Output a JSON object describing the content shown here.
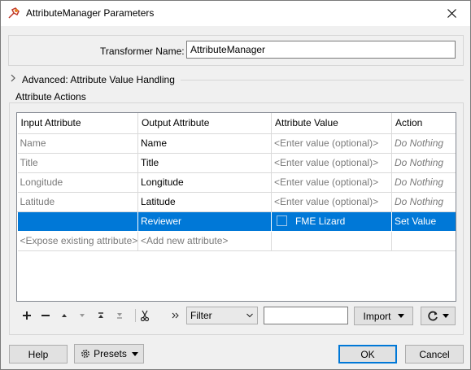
{
  "window": {
    "title": "AttributeManager Parameters"
  },
  "transformer": {
    "label": "Transformer Name:",
    "value": "AttributeManager"
  },
  "advanced": {
    "label": "Advanced: Attribute Value Handling"
  },
  "actions": {
    "label": "Attribute Actions"
  },
  "table": {
    "headers": [
      "Input Attribute",
      "Output Attribute",
      "Attribute Value",
      "Action"
    ],
    "rows": [
      {
        "input": "Name",
        "output": "Name",
        "value": "<Enter value (optional)>",
        "action": "Do Nothing"
      },
      {
        "input": "Title",
        "output": "Title",
        "value": "<Enter value (optional)>",
        "action": "Do Nothing"
      },
      {
        "input": "Longitude",
        "output": "Longitude",
        "value": "<Enter value (optional)>",
        "action": "Do Nothing"
      },
      {
        "input": "Latitude",
        "output": "Latitude",
        "value": "<Enter value (optional)>",
        "action": "Do Nothing"
      },
      {
        "input": "",
        "output": "Reviewer",
        "value": "FME Lizard",
        "action": "Set Value",
        "selected": true
      }
    ],
    "add_row": {
      "input": "<Expose existing attribute>",
      "output": "<Add new attribute>"
    }
  },
  "toolbar": {
    "icons": [
      "add-icon",
      "remove-icon",
      "move-up-icon",
      "move-down-icon",
      "move-top-icon",
      "move-bottom-icon",
      "cut-icon",
      "more-icon"
    ],
    "filter_value": "Filter",
    "search_value": "",
    "import_label": "Import"
  },
  "footer": {
    "help_label": "Help",
    "presets_label": "Presets",
    "ok_label": "OK",
    "cancel_label": "Cancel"
  },
  "colors": {
    "selection": "#0078d7",
    "accent_border": "#0078d7"
  }
}
